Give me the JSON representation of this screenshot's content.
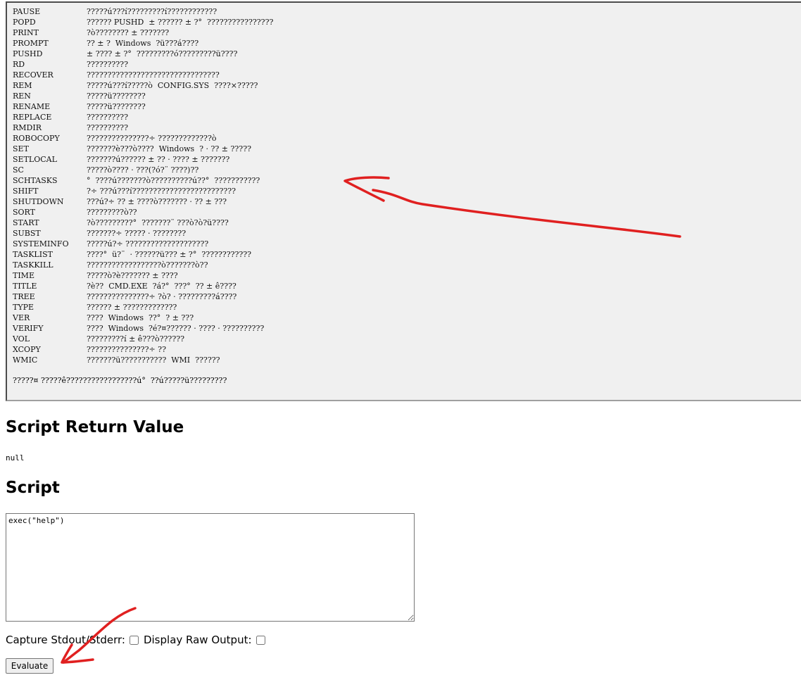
{
  "output": {
    "commands": [
      {
        "name": "PAUSE",
        "desc": "?????ú???í?????????í????????????"
      },
      {
        "name": "POPD",
        "desc": "?????? PUSHD  ± ?????? ± ?°  ????????????????"
      },
      {
        "name": "PRINT",
        "desc": "?ò???????? ± ???????"
      },
      {
        "name": "PROMPT",
        "desc": "?? ± ?  Windows  ?ü???á????"
      },
      {
        "name": "PUSHD",
        "desc": "± ???? ± ?°  ?????????ó?????????ü????"
      },
      {
        "name": "RD",
        "desc": "??????????"
      },
      {
        "name": "RECOVER",
        "desc": "????????????????????????????????"
      },
      {
        "name": "REM",
        "desc": "?????ú???í?????ò  CONFIG.SYS  ????×?????"
      },
      {
        "name": "REN",
        "desc": "?????ü????????"
      },
      {
        "name": "RENAME",
        "desc": "?????ü????????"
      },
      {
        "name": "REPLACE",
        "desc": "??????????"
      },
      {
        "name": "RMDIR",
        "desc": "??????????"
      },
      {
        "name": "ROBOCOPY",
        "desc": "???????????????÷ ?????????????ò"
      },
      {
        "name": "SET",
        "desc": "???????è???ò????  Windows  ? · ?? ± ?????"
      },
      {
        "name": "SETLOCAL",
        "desc": "???????ú?????? ± ?? · ???? ± ???????"
      },
      {
        "name": "SC",
        "desc": "?????ò???? · ???(?ó?¨ ????)??"
      },
      {
        "name": "SCHTASKS",
        "desc": "°  ????ú???????ò??????????ú??°  ???????????"
      },
      {
        "name": "SHIFT",
        "desc": "?÷ ???ú???í?????????????????????????"
      },
      {
        "name": "SHUTDOWN",
        "desc": "???ú?÷ ?? ± ????ò??????? · ?? ± ???"
      },
      {
        "name": "SORT",
        "desc": "?????????ò??"
      },
      {
        "name": "START",
        "desc": "?ò?????????°  ???????¨ ???ò?ò?ü????"
      },
      {
        "name": "SUBST",
        "desc": "???????÷ ????? · ????????"
      },
      {
        "name": "SYSTEMINFO",
        "desc": "?????ú?÷ ????????????????????"
      },
      {
        "name": "TASKLIST",
        "desc": "????°  ü?¨  · ??????ü??? ± ?°  ????????????"
      },
      {
        "name": "TASKKILL",
        "desc": "??????????????????ò???????ò??"
      },
      {
        "name": "TIME",
        "desc": "?????ò?è??????? ± ????"
      },
      {
        "name": "TITLE",
        "desc": "?è??  CMD.EXE  ?á?°  ???°  ?? ± ê????"
      },
      {
        "name": "TREE",
        "desc": "???????????????÷ ?ò? · ?????????á????"
      },
      {
        "name": "TYPE",
        "desc": "?????? ± ?????????????"
      },
      {
        "name": "VER",
        "desc": "????  Windows  ??°  ? ± ???"
      },
      {
        "name": "VERIFY",
        "desc": "????  Windows  ?é?¤?????? · ???? · ??????????"
      },
      {
        "name": "VOL",
        "desc": "?????????í ± ê???ò??????"
      },
      {
        "name": "XCOPY",
        "desc": "???????????????÷ ??"
      },
      {
        "name": "WMIC",
        "desc": "???????ü???????????  WMI  ??????"
      }
    ],
    "footer": "?????¤ ?????ê?????????????????ú°  ??ú?????ü?????????"
  },
  "return_section": {
    "heading": "Script Return Value",
    "value": "null"
  },
  "script_section": {
    "heading": "Script",
    "code": "exec(\"help\")"
  },
  "options": {
    "capture_label": "Capture Stdout/Stderr:",
    "capture_checked": false,
    "raw_label": "Display Raw Output:",
    "raw_checked": false
  },
  "evaluate_label": "Evaluate",
  "annotation_color": "#e02020"
}
